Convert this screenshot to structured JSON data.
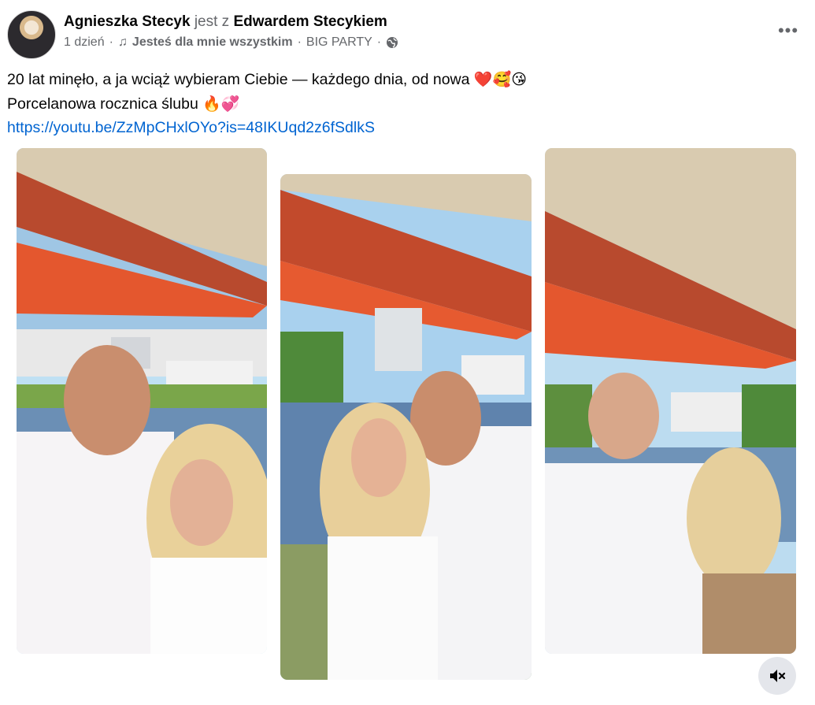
{
  "post": {
    "author": "Agnieszka Stecyk",
    "with_prefix": "jest z",
    "with_person": "Edwardem Stecykiem",
    "time": "1 dzień",
    "separator": "·",
    "music_icon": "♫",
    "song": "Jesteś dla mnie wszystkim",
    "artist": "BIG PARTY",
    "audience_icon": "globe-icon",
    "more_label": "•••",
    "line1": "20 lat minęło, a ja wciąż wybieram Ciebie — każdego dnia, od nowa",
    "line1_emoji": "❤️🥰😘",
    "line2": "Porcelanowa rocznica ślubu",
    "line2_emoji": "🔥💞",
    "link": "https://youtu.be/ZzMpCHxlOYo?is=48IKUqd2z6fSdlkS"
  },
  "photos": [
    {
      "icon": "photo-couple-smiling"
    },
    {
      "icon": "photo-couple-kissing"
    },
    {
      "icon": "photo-couple-from-behind"
    }
  ],
  "controls": {
    "mute_icon": "speaker-muted-icon"
  },
  "colors": {
    "link": "#0064d1",
    "muted_text": "#65676b",
    "button_bg": "#e4e6eb"
  }
}
